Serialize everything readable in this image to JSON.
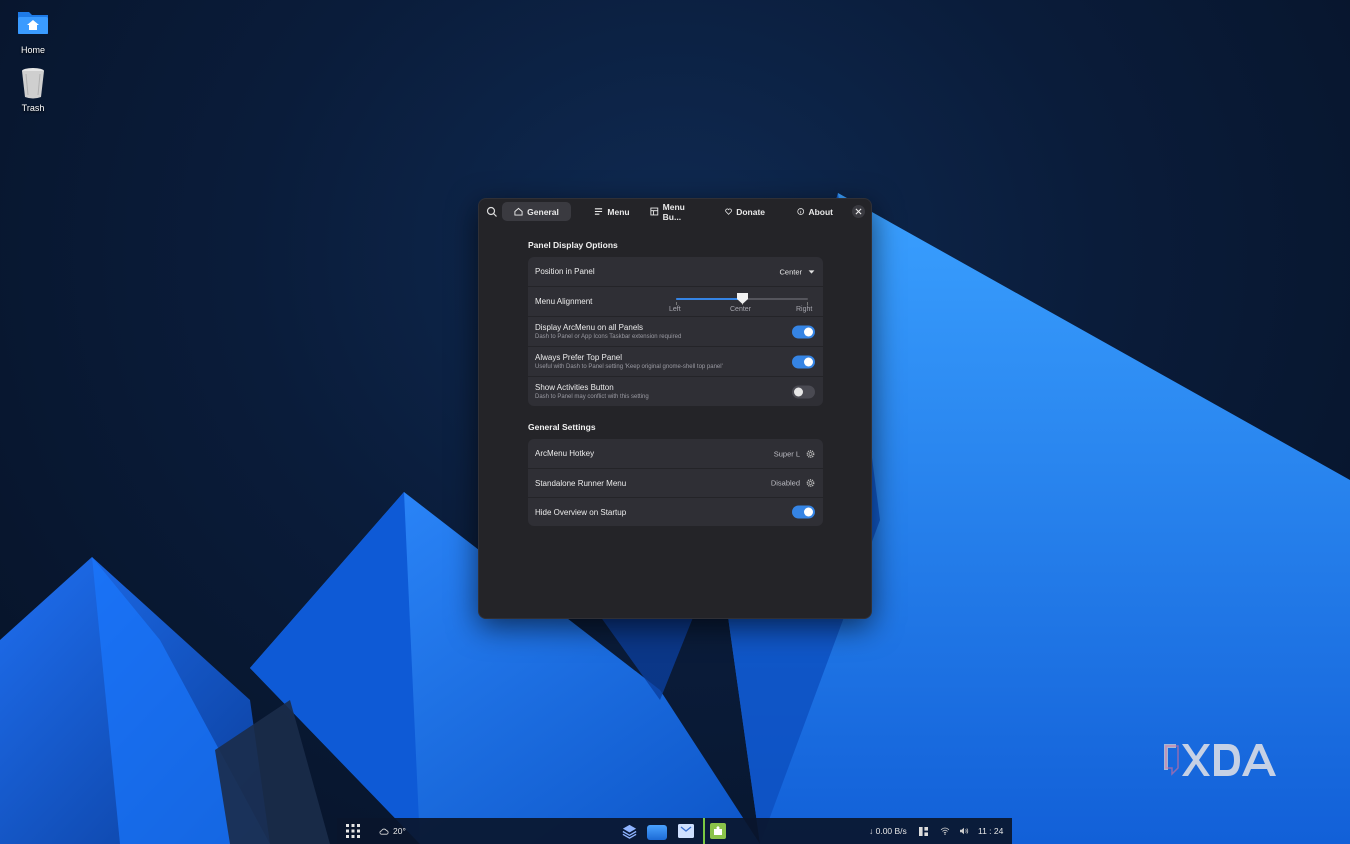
{
  "desktop": {
    "icons": [
      {
        "label": "Home",
        "icon": "home-folder-icon"
      },
      {
        "label": "Trash",
        "icon": "trash-icon"
      }
    ]
  },
  "window": {
    "tabs": [
      {
        "label": "General",
        "icon": "home-icon",
        "active": true
      },
      {
        "label": "Menu",
        "icon": "menu-list-icon",
        "active": false
      },
      {
        "label": "Menu Bu...",
        "icon": "layout-icon",
        "active": false
      },
      {
        "label": "Donate",
        "icon": "heart-icon",
        "active": false
      },
      {
        "label": "About",
        "icon": "info-icon",
        "active": false
      }
    ],
    "panel_display": {
      "title": "Panel Display Options",
      "position": {
        "label": "Position in Panel",
        "value": "Center"
      },
      "alignment": {
        "label": "Menu Alignment",
        "ticks": [
          "Left",
          "Center",
          "Right"
        ],
        "value_fraction": 0.5
      },
      "toggles": [
        {
          "label": "Display ArcMenu on all Panels",
          "sub": "Dash to Panel or App Icons Taskbar extension required",
          "on": true
        },
        {
          "label": "Always Prefer Top Panel",
          "sub": "Useful with Dash to Panel setting 'Keep original gnome-shell top panel'",
          "on": true
        },
        {
          "label": "Show Activities Button",
          "sub": "Dash to Panel may conflict with this setting",
          "on": false
        }
      ]
    },
    "general_settings": {
      "title": "General Settings",
      "hotkey": {
        "label": "ArcMenu Hotkey",
        "value": "Super L"
      },
      "runner": {
        "label": "Standalone Runner Menu",
        "value": "Disabled"
      },
      "hide_overview": {
        "label": "Hide Overview on Startup",
        "on": true
      }
    }
  },
  "taskbar": {
    "weather": "20°",
    "net_speed": "↓ 0.00 B/s",
    "clock": "11 : 24"
  },
  "colors": {
    "accent": "#3584e4",
    "window_bg": "#242428",
    "row_bg": "#2f2f35"
  }
}
